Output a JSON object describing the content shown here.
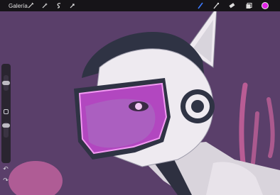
{
  "toolbar": {
    "gallery_label": "Galería"
  },
  "colors": {
    "accent": "#e024e6",
    "background": "#5a3f6a",
    "toolbar_bg": "#161418",
    "visor": "#c94bd6"
  },
  "icons": {
    "actions": "wrench-icon",
    "adjustments": "magic-wand-icon",
    "selection": "selection-s-icon",
    "transform": "arrow-cursor-icon",
    "brush": "brush-icon",
    "smudge": "smudge-icon",
    "eraser": "eraser-icon",
    "layers": "layers-icon"
  }
}
